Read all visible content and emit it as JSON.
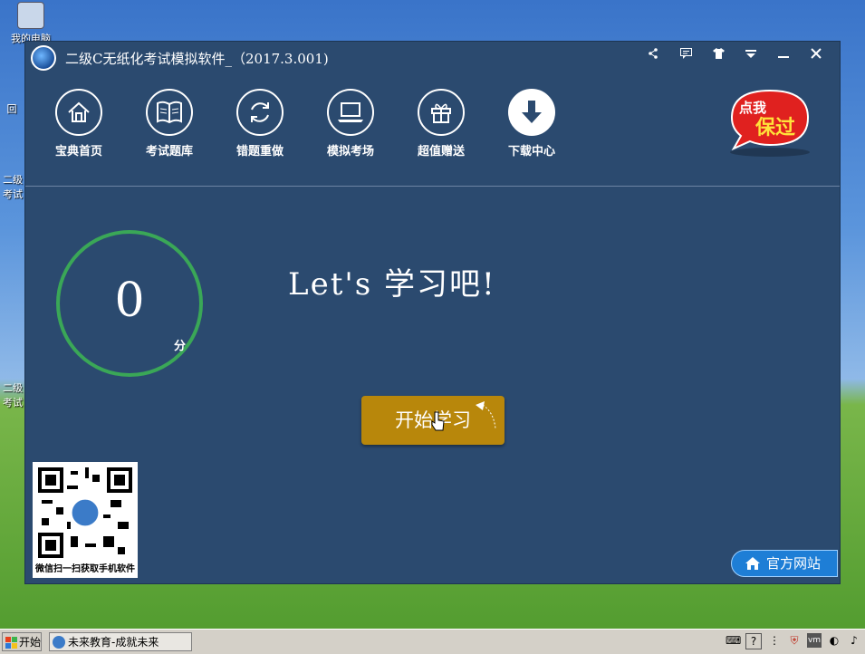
{
  "desktop": {
    "icons": [
      {
        "label": "我的电脑"
      },
      {
        "label": "回"
      },
      {
        "label": "二级"
      },
      {
        "label": "考试"
      },
      {
        "label": "二级"
      },
      {
        "label": "考试"
      }
    ]
  },
  "window": {
    "title": "二级C无纸化考试模拟软件_（2017.3.001)",
    "titlebar_icons": [
      "share-icon",
      "message-icon",
      "shirt-icon",
      "dropdown-icon",
      "minimize-icon",
      "close-icon"
    ]
  },
  "nav": {
    "items": [
      {
        "label": "宝典首页",
        "icon": "home-icon"
      },
      {
        "label": "考试题库",
        "icon": "book-icon"
      },
      {
        "label": "错题重做",
        "icon": "refresh-icon"
      },
      {
        "label": "模拟考场",
        "icon": "laptop-icon"
      },
      {
        "label": "超值赠送",
        "icon": "gift-icon"
      },
      {
        "label": "下载中心",
        "icon": "download-icon"
      }
    ]
  },
  "promo": {
    "line1": "点我",
    "line2": "保过"
  },
  "score": {
    "value": "0",
    "unit": "分"
  },
  "headline": "Let's 学习吧!",
  "start_button": "开始学习",
  "qr": {
    "caption": "微信扫一扫获取手机软件"
  },
  "official_site": "官方网站",
  "taskbar": {
    "start_label": "开始",
    "task_label": "未来教育-成就未来"
  },
  "colors": {
    "window_bg": "#2b4a6f",
    "ring": "#3aa757",
    "start_button": "#b8870b",
    "official_button": "#1e7ed6"
  }
}
